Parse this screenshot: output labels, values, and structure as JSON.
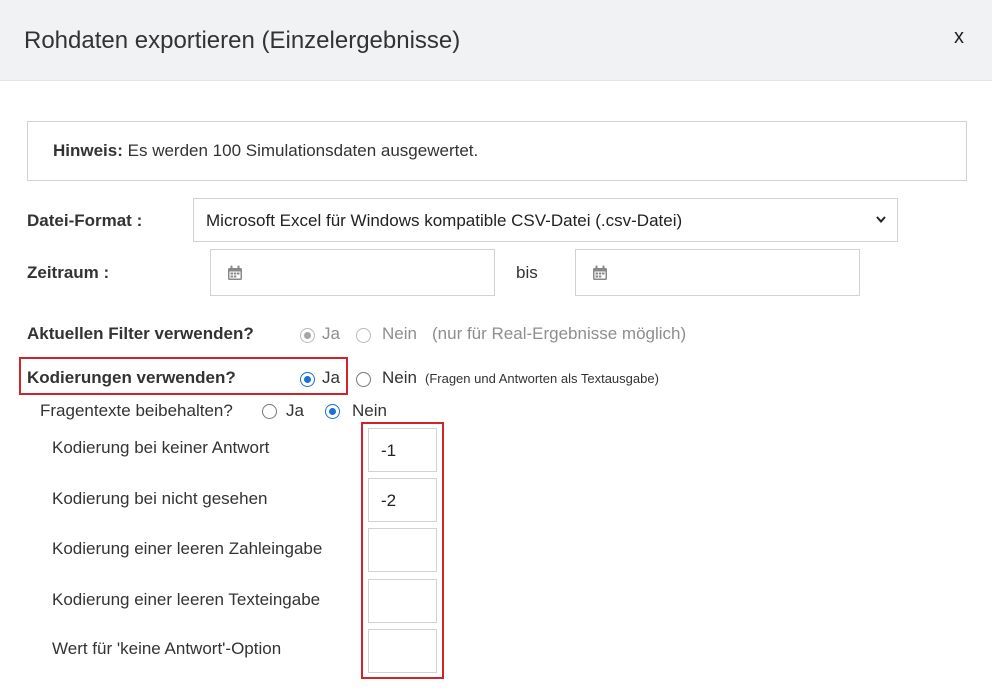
{
  "dialog": {
    "title": "Rohdaten exportieren (Einzelergebnisse)",
    "close_label": "x"
  },
  "notice": {
    "label": "Hinweis:",
    "text": " Es werden 100 Simulationsdaten ausgewertet."
  },
  "file_format": {
    "label": "Datei-Format :",
    "selected": "Microsoft Excel für Windows kompatible CSV-Datei (.csv-Datei)",
    "icon": "chevron-down-icon"
  },
  "period": {
    "label": "Zeitraum :",
    "from_value": "",
    "separator": "bis",
    "to_value": "",
    "icon": "calendar-icon"
  },
  "current_filter": {
    "label": "Aktuellen Filter verwenden?",
    "options": [
      "Ja",
      "Nein"
    ],
    "selected": "Ja",
    "disabled": true,
    "note": "(nur für Real-Ergebnisse möglich)"
  },
  "codings": {
    "label": "Kodierungen verwenden?",
    "options": [
      "Ja",
      "Nein"
    ],
    "selected": "Ja",
    "note": "(Fragen und Antworten als Textausgabe)"
  },
  "keep_question_texts": {
    "label": "Fragentexte beibehalten?",
    "options": [
      "Ja",
      "Nein"
    ],
    "selected": "Nein"
  },
  "coding_fields": [
    {
      "label": "Kodierung bei keiner Antwort",
      "value": "-1"
    },
    {
      "label": "Kodierung bei nicht gesehen",
      "value": "-2"
    },
    {
      "label": "Kodierung einer leeren Zahleingabe",
      "value": ""
    },
    {
      "label": "Kodierung einer leeren Texteingabe",
      "value": ""
    },
    {
      "label": "Wert für 'keine Antwort'-Option",
      "value": ""
    }
  ],
  "colors": {
    "accent": "#1d6fd1",
    "highlight": "#d2232a",
    "header_bg": "#f1f2f3"
  }
}
